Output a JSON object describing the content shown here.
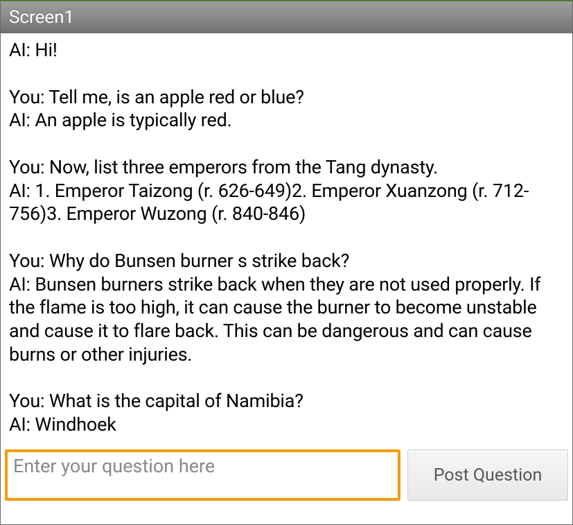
{
  "titlebar": {
    "title": "Screen1"
  },
  "conversation": {
    "lines": [
      "AI: Hi!",
      "",
      "You: Tell me, is an apple red or blue?",
      "AI: An apple is typically red.",
      "",
      "You: Now, list three emperors from the Tang dynasty.",
      "AI: 1. Emperor Taizong (r. 626-649)2. Emperor Xuanzong (r. 712-756)3. Emperor Wuzong (r. 840-846)",
      "",
      "You: Why do Bunsen burner s strike back?",
      "AI: Bunsen burners strike back when they are not used properly. If the flame is too high, it can cause the burner to become unstable and cause it to flare back. This can be dangerous and can cause burns or other injuries.",
      "",
      "You: What is the capital of Namibia?",
      "AI: Windhoek"
    ]
  },
  "input": {
    "placeholder": "Enter your question here",
    "value": "",
    "button_label": "Post Question"
  }
}
